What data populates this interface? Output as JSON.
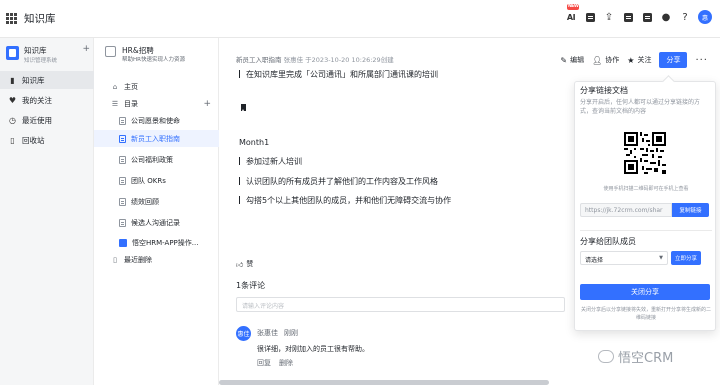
{
  "header": {
    "app_title": "知识库",
    "ai_badge": "NEW",
    "ai_label": "AI",
    "avatar_text": "惠",
    "icons": [
      "grid-icon",
      "ai-icon",
      "check-icon",
      "upload-icon",
      "doc-icon",
      "calendar-icon",
      "bell-icon",
      "help-icon"
    ]
  },
  "leftnav": {
    "kb_name": "知识库",
    "kb_desc": "知识管理系统",
    "add_symbol": "+",
    "items": [
      {
        "label": "知识库",
        "icon": "book-icon",
        "active": true
      },
      {
        "label": "我的关注",
        "icon": "heart-icon",
        "active": false
      },
      {
        "label": "最近使用",
        "icon": "clock-icon",
        "active": false
      },
      {
        "label": "回收站",
        "icon": "trash-icon",
        "active": false
      }
    ]
  },
  "tree": {
    "space_name": "HR&招聘",
    "space_desc": "帮助HR快速实现人力资源",
    "home": "主页",
    "toc": "目录",
    "add_symbol": "+",
    "docs": [
      {
        "label": "公司愿景和使命",
        "active": false
      },
      {
        "label": "新员工入职指南",
        "active": true
      },
      {
        "label": "公司福利政策",
        "active": false
      },
      {
        "label": "团队 OKRs",
        "active": false
      },
      {
        "label": "绩效回顾",
        "active": false
      },
      {
        "label": "候选人沟通记录",
        "active": false
      },
      {
        "label": "悟空HRM-APP操作...",
        "active": false
      }
    ],
    "recent_deleted": "最近删除"
  },
  "doc": {
    "title": "新员工入职指南",
    "author": "张惠佳",
    "created": "于2023-10-20 10:26:29创建",
    "actions": {
      "edit": "编辑",
      "collab": "协作",
      "follow": "关注",
      "share": "分享",
      "more": "···"
    },
    "line1": "在知识库里完成「公司通讯」和所属部门通讯课的培训",
    "month": "Month1",
    "bullets": [
      "参加过新人培训",
      "认识团队的所有成员并了解他们的工作内容及工作风格",
      "勾搭5个以上其他团队的成员，并和他们无障碍交流与协作"
    ],
    "like": "赞",
    "comment_count": "1条评论",
    "comment_placeholder": "请输入评论内容",
    "comment": {
      "avatar": "惠佳",
      "user": "张惠佳",
      "time": "刚刚",
      "text": "很详细，对刚加入的员工很有帮助。",
      "reply": "回复",
      "delete": "删除"
    }
  },
  "share_popup": {
    "title": "分享链接文档",
    "desc": "分享开启后，任何人都可以通过分享链接的方式，查询当前文档的内容",
    "qr_hint": "使用手机扫描二维码即可在手机上查看",
    "link": "https://jk.72crm.com/shar",
    "copy": "复制链接",
    "share_members": "分享给团队成员",
    "select_placeholder": "请选择",
    "add_now": "立即分享",
    "close": "关闭分享",
    "footer": "关闭分享后以分享链接将失效，重新打开分享将生成新的二维码链接"
  },
  "watermark": "悟空CRM",
  "colors": {
    "accent": "#3370ff",
    "active_bg": "#eef3ff",
    "nav_bg": "#f5f6f7"
  }
}
